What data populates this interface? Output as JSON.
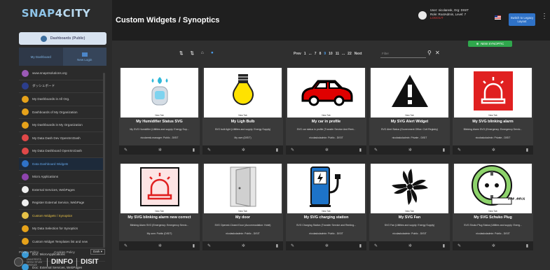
{
  "app": {
    "logo": {
      "prefix": "SNAP",
      "suffix": "4CITY"
    },
    "page_title": "Custom Widgets / Synoptics"
  },
  "sidebar": {
    "dashboards_button": "Dashboards (Public)",
    "subnav": [
      {
        "label": "My Dashboard"
      },
      {
        "label": "New Login"
      }
    ],
    "items": [
      {
        "label": "www.snap4solutions.org",
        "color": "#9b59b6"
      },
      {
        "label": "ダッシュボード",
        "color": "#2c3e8c"
      },
      {
        "label": "My Dashboards in All Org.",
        "color": "#e6a21a"
      },
      {
        "label": "Dashboards of My Organization",
        "color": "#e6a21a"
      },
      {
        "label": "My Dashboards in My Organization",
        "color": "#e6a21a"
      },
      {
        "label": "My Data Dash Dev OpenSrcDash",
        "color": "#e04848"
      },
      {
        "label": "My Data Dashboard OpenSrcDash",
        "color": "#e04848"
      },
      {
        "label": "Data Dashboard Widgets",
        "color": "#2f72c7"
      },
      {
        "label": "Micro Applications",
        "color": "#8e44ad"
      },
      {
        "label": "External Services, WebPages",
        "color": "#f0f0f0"
      },
      {
        "label": "Register External Service, WebPage",
        "color": "#f0f0f0"
      },
      {
        "label": "Custom Widgets / Synoptics",
        "color": "#e6c147"
      },
      {
        "label": "My Data Selection for Synoptics",
        "color": "#e6a21a"
      },
      {
        "label": "Custom Widget Templates list and new",
        "color": "#e6a21a"
      },
      {
        "label": "Doc: MicroApplications",
        "color": "#3a9bd8"
      },
      {
        "label": "Doc: External Services, WebPages",
        "color": "#3a9bd8"
      }
    ],
    "footer": {
      "privacy": "Privacy Policy",
      "cookies": "Cookies Policy",
      "theme": "Dark"
    },
    "brands": {
      "university": "UNIVERSITÀ DEGLI STUDI FIRENZE",
      "dinfo": "DINFO",
      "disit": "DISIT"
    }
  },
  "header": {
    "user_line1": "User: nicolaresk, Org: DISIT",
    "user_line2": "Role: RootAdmin, Level: 7",
    "logout": "LOGOUT",
    "legacy_button": "Switch to Legacy Layout"
  },
  "toolbar": {
    "new_synoptic": "NEW SYNOPTIC",
    "pager": [
      "Prev",
      "1",
      "...",
      "7",
      "8",
      "9",
      "10",
      "11",
      "...",
      "22",
      "Next"
    ],
    "current_page": "9",
    "filter_placeholder": "Filter"
  },
  "cards": [
    {
      "tag": "New Tab",
      "title": "My Humidifier Status SVG",
      "desc": "My SVG Humidifier (Utilities and supply: Energy Sup...",
      "owner": "nicolaresk.manager: Public - DISIT",
      "icon": "humidifier-icon"
    },
    {
      "tag": "New Tab",
      "title": "My Ligh Bulb",
      "desc": "SVG bulb light (Utilities and supply: Energy Supply)",
      "owner": "My own (DISIT)",
      "icon": "light-bulb-icon"
    },
    {
      "tag": "New Tab",
      "title": "My car in profile",
      "desc": "SVG car status in profile (Transfer Service And Rent...",
      "owner": "nicolaskoladmin: Public - DISIT",
      "icon": "car-icon"
    },
    {
      "tag": "New Tab",
      "title": "My SVG Alert Widget",
      "desc": "SVG Alert Status (Government Office: Civil Registry)",
      "owner": "nicolaskoladmin: Private - DISIT",
      "icon": "alert-triangle-icon"
    },
    {
      "tag": "New Tab",
      "title": "My SVG blinking alarm",
      "desc": "Blinking Alarm SVG (Emergency: Emergency Servic...",
      "owner": "nicolaskoladmin: Private - DISIT",
      "icon": "alarm-light-icon"
    },
    {
      "tag": "New Tab",
      "title": "My SVG blinking alarm new correct",
      "desc": "Blinking Alarm SVG (Emergency: Emergency Servic...",
      "owner": "My own: Public (DISIT)",
      "icon": "alarm-light-icon"
    },
    {
      "tag": "New Tab",
      "title": "My door",
      "desc": "SVG Opened-Closed Door (Accommodation: Hotel)",
      "owner": "nicolaskoladmin: Public - DISIT",
      "icon": "door-icon"
    },
    {
      "tag": "New Tab",
      "title": "My SVG charging station",
      "desc": "SVG Charging Station (Transfer Service and Renting...",
      "owner": "nicolaskoladmin: Public - DISIT",
      "icon": "charging-station-icon"
    },
    {
      "tag": "New Tab",
      "title": "My SVG Fan",
      "desc": "SVG Fan (Utilities and supply: Energy Supply)",
      "owner": "nicolaskoladmin: Public - DISIT",
      "icon": "fan-icon"
    },
    {
      "tag": "New Tab",
      "title": "My SVG Schuko Plug",
      "desc": "SVG Shuko Plug Status (Utilities and supply: Energ...",
      "owner": "nicolaskoladmin: Public - DISIT",
      "icon": "schuko-plug-icon"
    }
  ],
  "plug_label": "###.##kW"
}
